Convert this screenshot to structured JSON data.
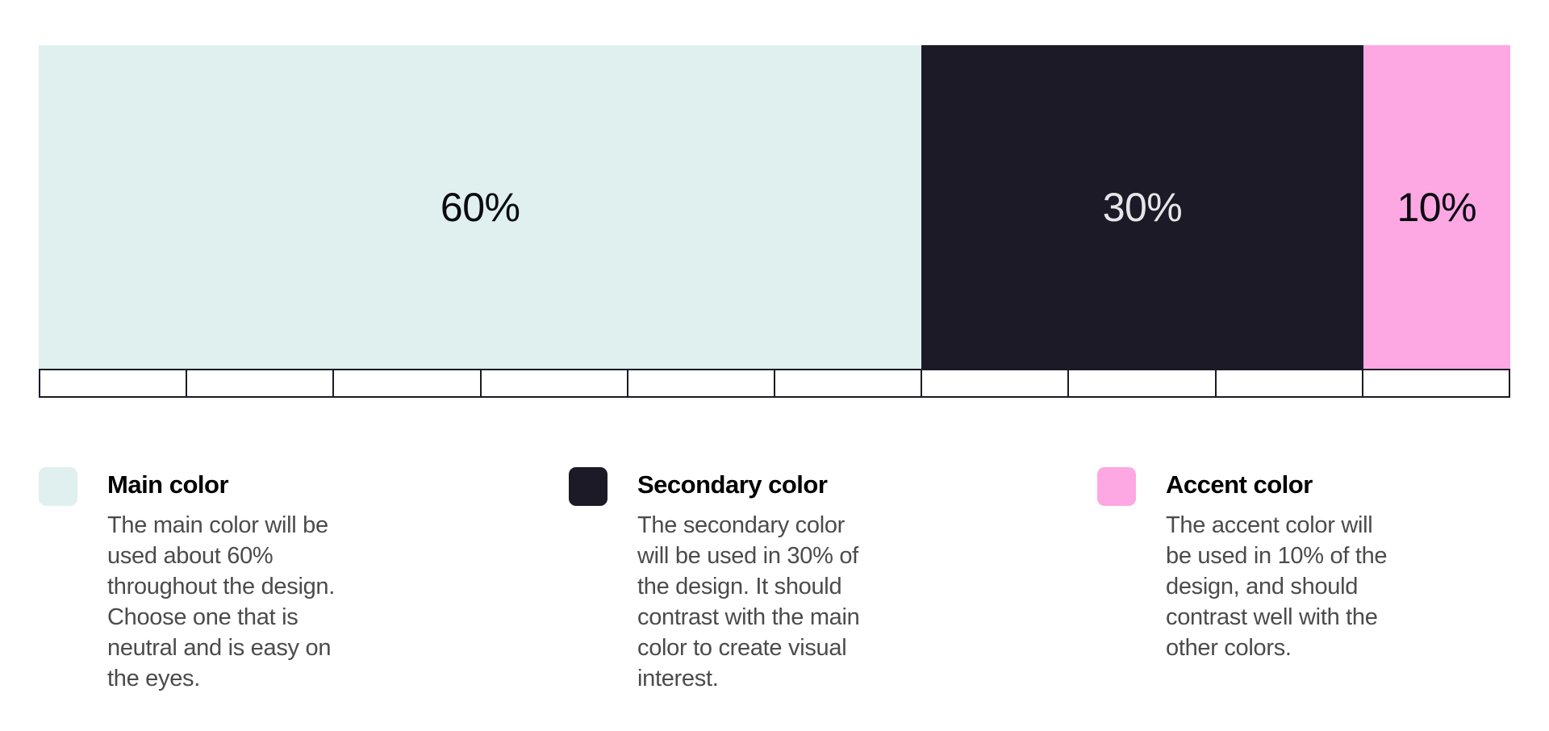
{
  "segments": [
    {
      "label": "60%",
      "share": 60,
      "color": "#dff0ee",
      "text_color": "#0b0b12"
    },
    {
      "label": "30%",
      "share": 30,
      "color": "#1b1a26",
      "text_color": "#e6e6ea"
    },
    {
      "label": "10%",
      "share": 10,
      "color": "#fda8e2",
      "text_color": "#0b0b12"
    }
  ],
  "ruler": {
    "divisions": 10
  },
  "legend": [
    {
      "title": "Main color",
      "swatch_color": "#dff0ee",
      "description_lines": [
        "The main color will be",
        "used about 60%",
        "throughout the design.",
        "Choose one that is",
        "neutral and is easy on",
        "the eyes."
      ]
    },
    {
      "title": "Secondary color",
      "swatch_color": "#1b1a26",
      "description_lines": [
        "The secondary color",
        "will be used in 30% of",
        "the design. It should",
        "contrast with the main",
        "color to create visual",
        "interest."
      ]
    },
    {
      "title": "Accent color",
      "swatch_color": "#fda8e2",
      "description_lines": [
        "The accent color will",
        "be used in 10% of the",
        "design, and should",
        "contrast well with the",
        "other colors."
      ]
    }
  ]
}
